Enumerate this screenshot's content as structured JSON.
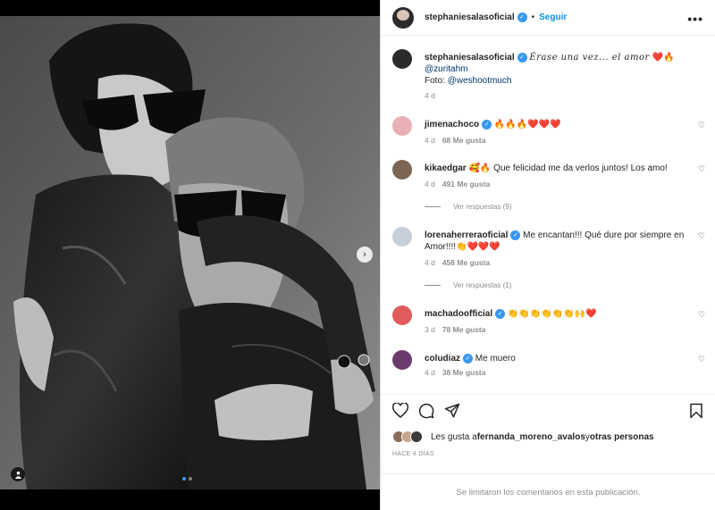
{
  "header": {
    "username": "stephaniesalasoficial",
    "separator": "•",
    "follow_label": "Seguir",
    "more_label": "•••"
  },
  "caption": {
    "username": "stephaniesalasoficial",
    "text": "Érase una vez... el amor",
    "emoji": "❤️🔥",
    "mention": "@zuritahm",
    "photo_prefix": "Foto: ",
    "photo_mention": "@weshootmuch",
    "time": "4 d"
  },
  "comments": [
    {
      "username": "jimenachoco",
      "text": "🔥🔥🔥❤️❤️❤️",
      "time": "4 d",
      "likes": "68 Me gusta",
      "avatar_color": "#e7b0b5"
    },
    {
      "username": "kikaedgar",
      "text": "🥰🔥 Que felicidad me da verlos juntos! Los amo!",
      "time": "4 d",
      "likes": "491 Me gusta",
      "replies": "Ver respuestas (9)",
      "avatar_color": "#7c6553"
    },
    {
      "username": "lorenaherreraoficial",
      "text": "Me encantan!!! Qué dure por siempre en Amor!!!!👏❤️❤️❤️",
      "time": "4 d",
      "likes": "458 Me gusta",
      "replies": "Ver respuestas (1)",
      "avatar_color": "#c7cfd8"
    },
    {
      "username": "machadoofficial",
      "text": "👏👏👏👏👏👏🙌❤️",
      "time": "3 d",
      "likes": "78 Me gusta",
      "avatar_color": "#e05b5b"
    },
    {
      "username": "coludiaz",
      "text": "Me muero",
      "time": "4 d",
      "likes": "38 Me gusta",
      "avatar_color": "#6b3b6e"
    }
  ],
  "actions": {
    "likes_prefix": "Les gusta a ",
    "liker": "fernanda_moreno_avalos",
    "likes_suffix": " y ",
    "others": "otras personas",
    "posted": "HACE 4 DÍAS",
    "comments_disabled": "Se limitaron los comentarios en esta publicación."
  },
  "colors": {
    "accent": "#0095f6",
    "verified": "#3897f0",
    "muted": "#8e8e8e",
    "heart": "#ed4956"
  },
  "icons": [
    "heart-icon",
    "comment-icon",
    "share-icon",
    "bookmark-icon",
    "more-icon",
    "chevron-right-icon",
    "user-tag-icon"
  ]
}
